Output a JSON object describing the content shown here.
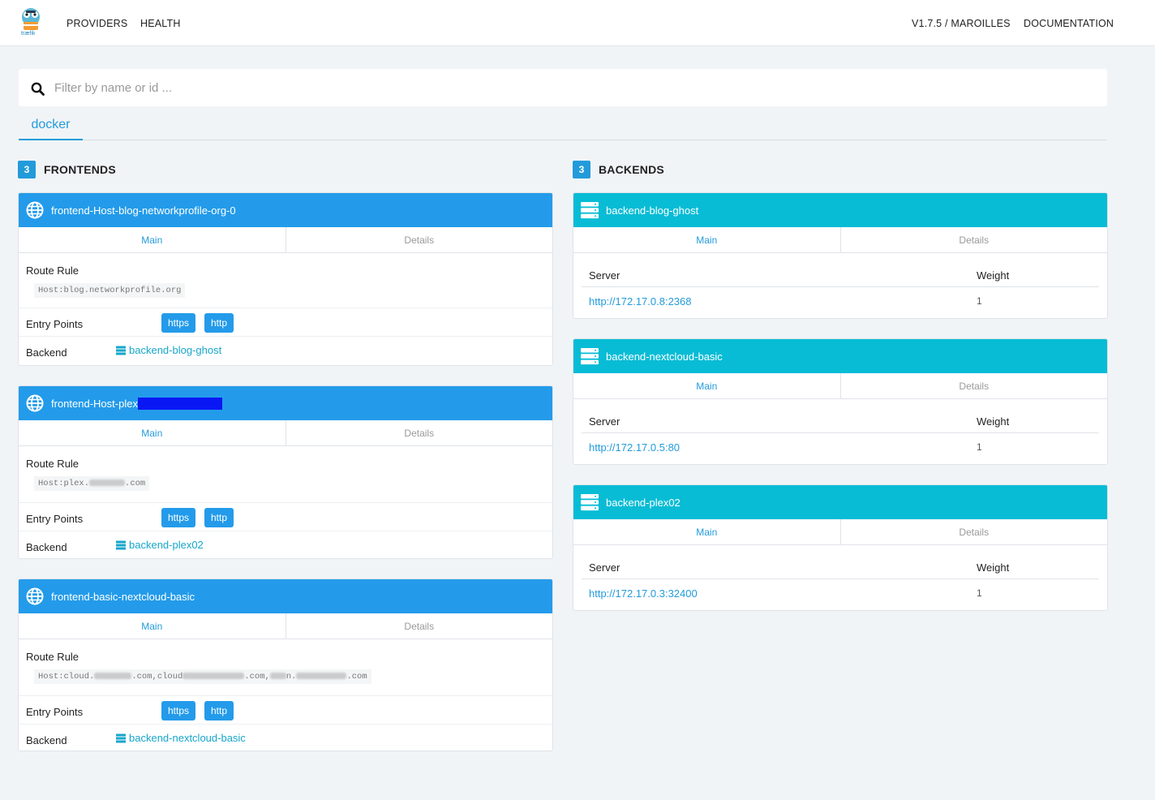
{
  "nav": {
    "logo_text": "træfik",
    "providers": "PROVIDERS",
    "health": "HEALTH",
    "version": "V1.7.5 / MAROILLES",
    "documentation": "DOCUMENTATION"
  },
  "filter": {
    "placeholder": "Filter by name or id ..."
  },
  "provider_tab": "docker",
  "frontends": {
    "count": "3",
    "title": "FRONTENDS",
    "items": [
      {
        "name": "frontend-Host-blog-networkprofile-org-0",
        "tab_main": "Main",
        "tab_details": "Details",
        "route_rule_label": "Route Rule",
        "route_rule": "Host:blog.networkprofile.org",
        "entry_points_label": "Entry Points",
        "entry_points": [
          "https",
          "http"
        ],
        "backend_label": "Backend",
        "backend": "backend-blog-ghost"
      },
      {
        "name": "frontend-Host-plex",
        "tab_main": "Main",
        "tab_details": "Details",
        "route_rule_label": "Route Rule",
        "route_rule_prefix": "Host:plex.",
        "route_rule_suffix": ".com",
        "entry_points_label": "Entry Points",
        "entry_points": [
          "https",
          "http"
        ],
        "backend_label": "Backend",
        "backend": "backend-plex02"
      },
      {
        "name": "frontend-basic-nextcloud-basic",
        "tab_main": "Main",
        "tab_details": "Details",
        "route_rule_label": "Route Rule",
        "route_rule_parts": [
          "Host:cloud.",
          ".com,cloud",
          ".com,",
          "n.",
          ".com"
        ],
        "entry_points_label": "Entry Points",
        "entry_points": [
          "https",
          "http"
        ],
        "backend_label": "Backend",
        "backend": "backend-nextcloud-basic"
      }
    ]
  },
  "backends": {
    "count": "3",
    "title": "BACKENDS",
    "server_label": "Server",
    "weight_label": "Weight",
    "items": [
      {
        "name": "backend-blog-ghost",
        "tab_main": "Main",
        "tab_details": "Details",
        "server": "http://172.17.0.8:2368",
        "weight": "1"
      },
      {
        "name": "backend-nextcloud-basic",
        "tab_main": "Main",
        "tab_details": "Details",
        "server": "http://172.17.0.5:80",
        "weight": "1"
      },
      {
        "name": "backend-plex02",
        "tab_main": "Main",
        "tab_details": "Details",
        "server": "http://172.17.0.3:32400",
        "weight": "1"
      }
    ]
  },
  "colors": {
    "accent": "#239bda",
    "frontend_header": "#239bea",
    "backend_header": "#08bcd5",
    "redaction": "#0a17f5",
    "background": "#f1f4f7"
  },
  "icons": {
    "search": "search-icon",
    "frontend": "globe-icon",
    "backend": "server-icon",
    "logo": "traefik-gopher-logo"
  }
}
